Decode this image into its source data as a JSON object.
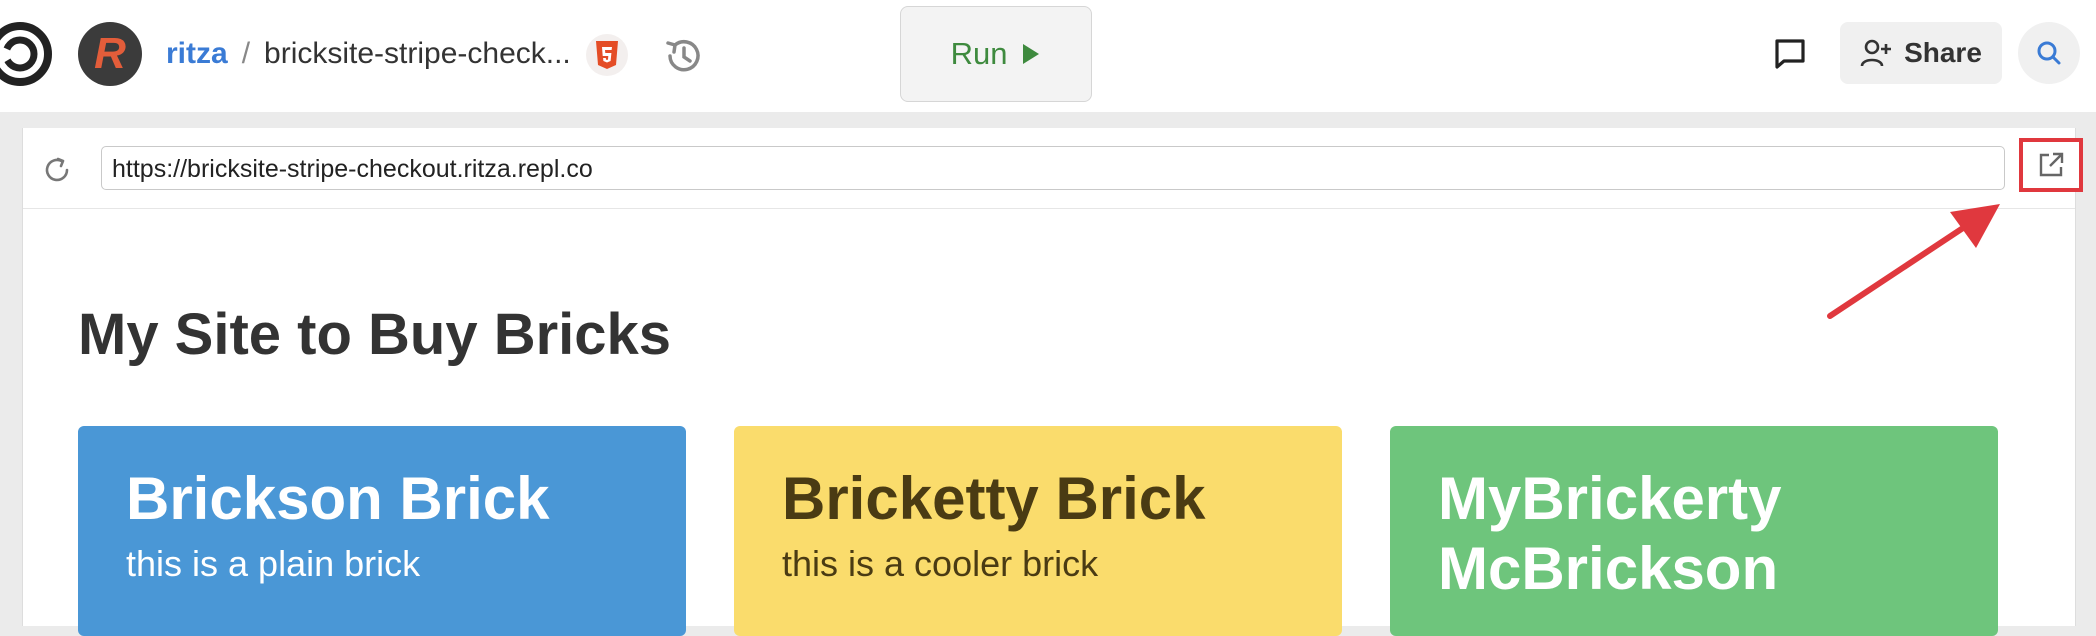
{
  "header": {
    "owner": "ritza",
    "separator": "/",
    "repl_name": "bricksite-stripe-check...",
    "run_label": "Run",
    "share_label": "Share",
    "avatar_letter": "R"
  },
  "preview": {
    "url": "https://bricksite-stripe-checkout.ritza.repl.co",
    "page_title": "My Site to Buy Bricks",
    "cards": [
      {
        "title": "Brickson Brick",
        "subtitle": "this is a plain brick"
      },
      {
        "title": "Bricketty Brick",
        "subtitle": "this is a cooler brick"
      },
      {
        "title": "MyBrickerty McBrickson",
        "subtitle": ""
      }
    ]
  },
  "colors": {
    "accent_blue": "#4a97d6",
    "accent_yellow": "#fadc6c",
    "accent_green": "#6ec57c",
    "highlight_red": "#e0383e",
    "run_green": "#3e8a3e"
  },
  "icons": [
    "replit-logo-icon",
    "html5-icon",
    "history-icon",
    "play-icon",
    "chat-icon",
    "add-user-icon",
    "search-icon",
    "reload-icon",
    "open-new-tab-icon"
  ]
}
